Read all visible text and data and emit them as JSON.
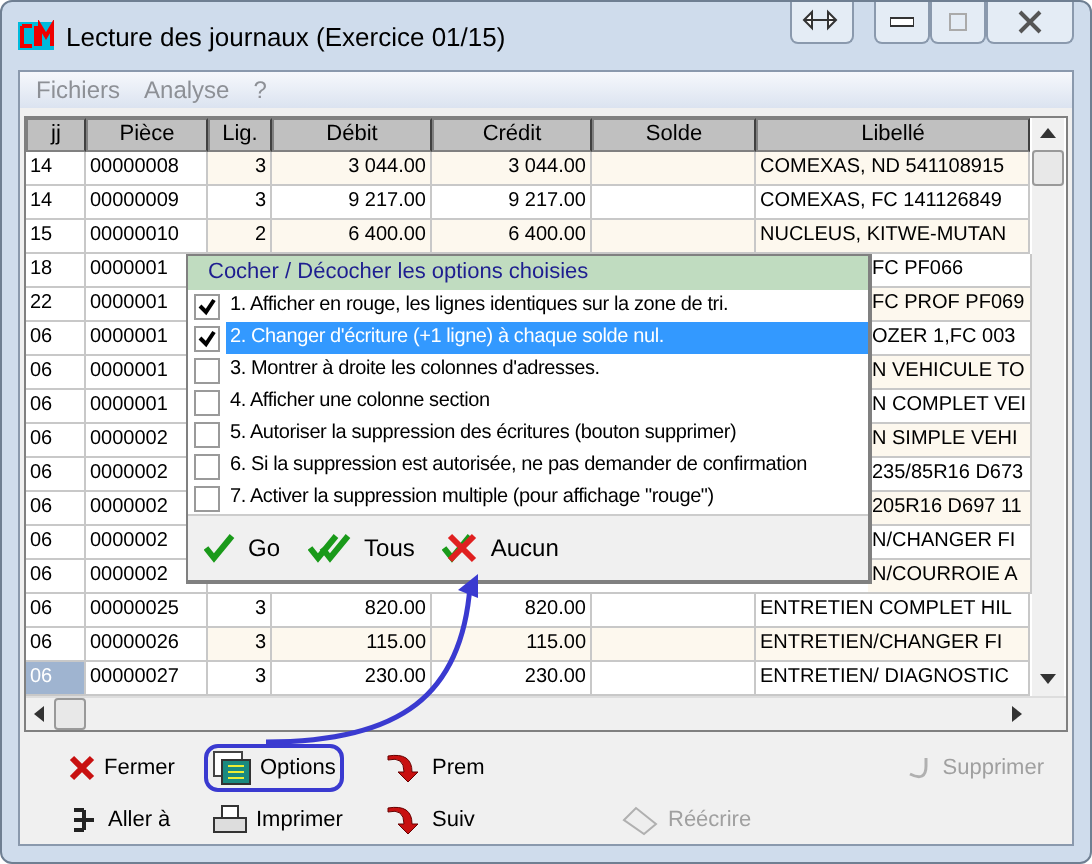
{
  "window": {
    "title": "Lecture des journaux (Exercice 01/15)"
  },
  "menu": [
    {
      "label": "Fichiers"
    },
    {
      "label": "Analyse"
    },
    {
      "label": "?"
    }
  ],
  "table": {
    "columns": [
      "jj",
      "Pièce",
      "Lig.",
      "Débit",
      "Crédit",
      "Solde",
      "Libellé"
    ],
    "rows": [
      {
        "kind": "full",
        "selected": false,
        "cells": [
          "14",
          "00000008",
          "3",
          "3 044.00",
          "3 044.00",
          "",
          "COMEXAS, ND 541108915"
        ]
      },
      {
        "kind": "full",
        "selected": false,
        "cells": [
          "14",
          "00000009",
          "3",
          "9 217.00",
          "9 217.00",
          "",
          "COMEXAS, FC 141126849"
        ]
      },
      {
        "kind": "full",
        "selected": false,
        "cells": [
          "15",
          "00000010",
          "2",
          "6 400.00",
          "6 400.00",
          "",
          "NUCLEUS, KITWE-MUTAN"
        ]
      },
      {
        "kind": "covered",
        "selected": false,
        "cells": [
          "18",
          "0000001",
          "FC PF066"
        ]
      },
      {
        "kind": "covered",
        "selected": false,
        "cells": [
          "22",
          "0000001",
          "FC PROF PF069"
        ]
      },
      {
        "kind": "covered",
        "selected": false,
        "cells": [
          "06",
          "0000001",
          "OZER  1,FC 003"
        ]
      },
      {
        "kind": "covered",
        "selected": false,
        "cells": [
          "06",
          "0000001",
          "N VEHICULE TO"
        ]
      },
      {
        "kind": "covered",
        "selected": false,
        "cells": [
          "06",
          "0000001",
          "N COMPLET VEI"
        ]
      },
      {
        "kind": "covered",
        "selected": false,
        "cells": [
          "06",
          "0000002",
          "N SIMPLE VEHI"
        ]
      },
      {
        "kind": "covered",
        "selected": false,
        "cells": [
          "06",
          "0000002",
          "235/85R16 D673"
        ]
      },
      {
        "kind": "covered",
        "selected": false,
        "cells": [
          "06",
          "0000002",
          "205R16 D697 11"
        ]
      },
      {
        "kind": "covered",
        "selected": false,
        "cells": [
          "06",
          "0000002",
          "N/CHANGER  FI"
        ]
      },
      {
        "kind": "covered",
        "selected": false,
        "cells": [
          "06",
          "0000002",
          "N/COURROIE A"
        ]
      },
      {
        "kind": "full",
        "selected": false,
        "cells": [
          "06",
          "00000025",
          "3",
          "820.00",
          "820.00",
          "",
          "ENTRETIEN COMPLET HIL"
        ]
      },
      {
        "kind": "full",
        "selected": false,
        "cells": [
          "06",
          "00000026",
          "3",
          "115.00",
          "115.00",
          "",
          "ENTRETIEN/CHANGER  FI"
        ]
      },
      {
        "kind": "full",
        "selected": true,
        "cells": [
          "06",
          "00000027",
          "3",
          "230.00",
          "230.00",
          "",
          "ENTRETIEN/ DIAGNOSTIC"
        ]
      }
    ]
  },
  "options_popup": {
    "title": "Cocher / Décocher les options choisies",
    "items": [
      {
        "label": "1. Afficher en rouge, les lignes identiques sur la zone de tri.",
        "checked": true,
        "selected": false
      },
      {
        "label": "2. Changer d'écriture (+1 ligne) à chaque solde nul.",
        "checked": true,
        "selected": true
      },
      {
        "label": "3. Montrer à droite les colonnes d'adresses.",
        "checked": false,
        "selected": false
      },
      {
        "label": "4. Afficher une colonne section",
        "checked": false,
        "selected": false
      },
      {
        "label": "5. Autoriser la suppression des écritures (bouton supprimer)",
        "checked": false,
        "selected": false
      },
      {
        "label": "6. Si la suppression est autorisée, ne pas demander de confirmation",
        "checked": false,
        "selected": false
      },
      {
        "label": "7. Activer la suppression multiple (pour affichage \"rouge\")",
        "checked": false,
        "selected": false
      }
    ],
    "buttons": [
      {
        "label": "Go",
        "kind": "go"
      },
      {
        "label": "Tous",
        "kind": "all"
      },
      {
        "label": "Aucun",
        "kind": "none"
      }
    ]
  },
  "toolbar": [
    {
      "label": "Fermer",
      "kind": "close",
      "disabled": false,
      "highlighted": false
    },
    {
      "label": "Options",
      "kind": "options",
      "disabled": false,
      "highlighted": true
    },
    {
      "label": "Prem",
      "kind": "first",
      "disabled": false,
      "highlighted": false
    },
    {
      "label": "Supprimer",
      "kind": "delete",
      "disabled": true,
      "highlighted": false
    },
    {
      "label": "Aller à",
      "kind": "goto",
      "disabled": false,
      "highlighted": false
    },
    {
      "label": "Imprimer",
      "kind": "print",
      "disabled": false,
      "highlighted": false
    },
    {
      "label": "Suiv",
      "kind": "next",
      "disabled": false,
      "highlighted": false
    },
    {
      "label": "Réécrire",
      "kind": "rewrite",
      "disabled": true,
      "highlighted": false
    }
  ]
}
